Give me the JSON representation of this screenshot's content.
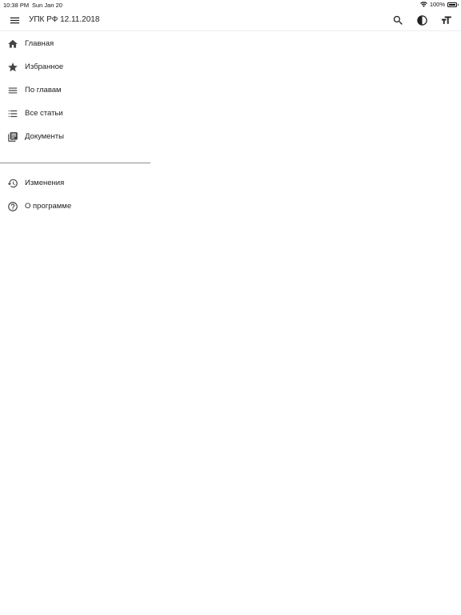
{
  "status_bar": {
    "time": "10:38 PM",
    "date": "Sun Jan 20",
    "battery": "100%"
  },
  "app_bar": {
    "title": "УПК РФ 12.11.2018",
    "icons": [
      "menu-icon",
      "search-icon",
      "contrast-icon",
      "font-size-icon"
    ]
  },
  "drawer": {
    "primary_items": [
      {
        "label": "Главная",
        "icon": "home-icon"
      },
      {
        "label": "Избранное",
        "icon": "star-icon"
      },
      {
        "label": "По главам",
        "icon": "list-icon"
      },
      {
        "label": "Все статьи",
        "icon": "checklist-icon"
      },
      {
        "label": "Документы",
        "icon": "library-icon"
      }
    ],
    "secondary_items": [
      {
        "label": "Изменения",
        "icon": "history-icon"
      },
      {
        "label": "О программе",
        "icon": "help-icon"
      }
    ]
  }
}
